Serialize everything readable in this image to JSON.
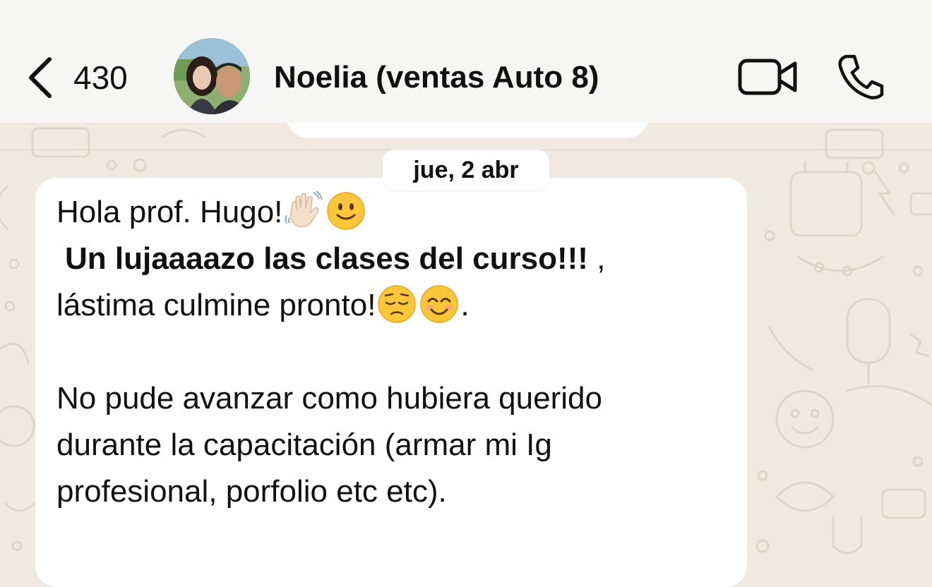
{
  "header": {
    "back_count": "430",
    "contact_name": "Noelia (ventas Auto 8)",
    "icons": [
      "back-chevron-icon",
      "video-call-icon",
      "phone-call-icon"
    ]
  },
  "chat": {
    "date_label": "jue, 2 abr",
    "message": {
      "line1": "Hola prof. Hugo!",
      "line2_bold": "Un lujaaaazo las clases del curso!!!",
      "line2_tail": " ,",
      "line3": "lástima culmine pronto!",
      "line3_tail": ".",
      "para2_line1": "No pude avanzar como hubiera querido",
      "para2_line2": "durante la capacitación (armar mi Ig",
      "para2_line3": "profesional, porfolio etc etc).",
      "emojis": [
        "waving-hand-emoji",
        "slightly-smiling-emoji",
        "pensive-face-emoji",
        "smiling-face-emoji"
      ]
    }
  },
  "colors": {
    "header_bg": "#f6f6f4",
    "wallpaper_bg": "#efe9df",
    "bubble_bg": "#ffffff"
  }
}
